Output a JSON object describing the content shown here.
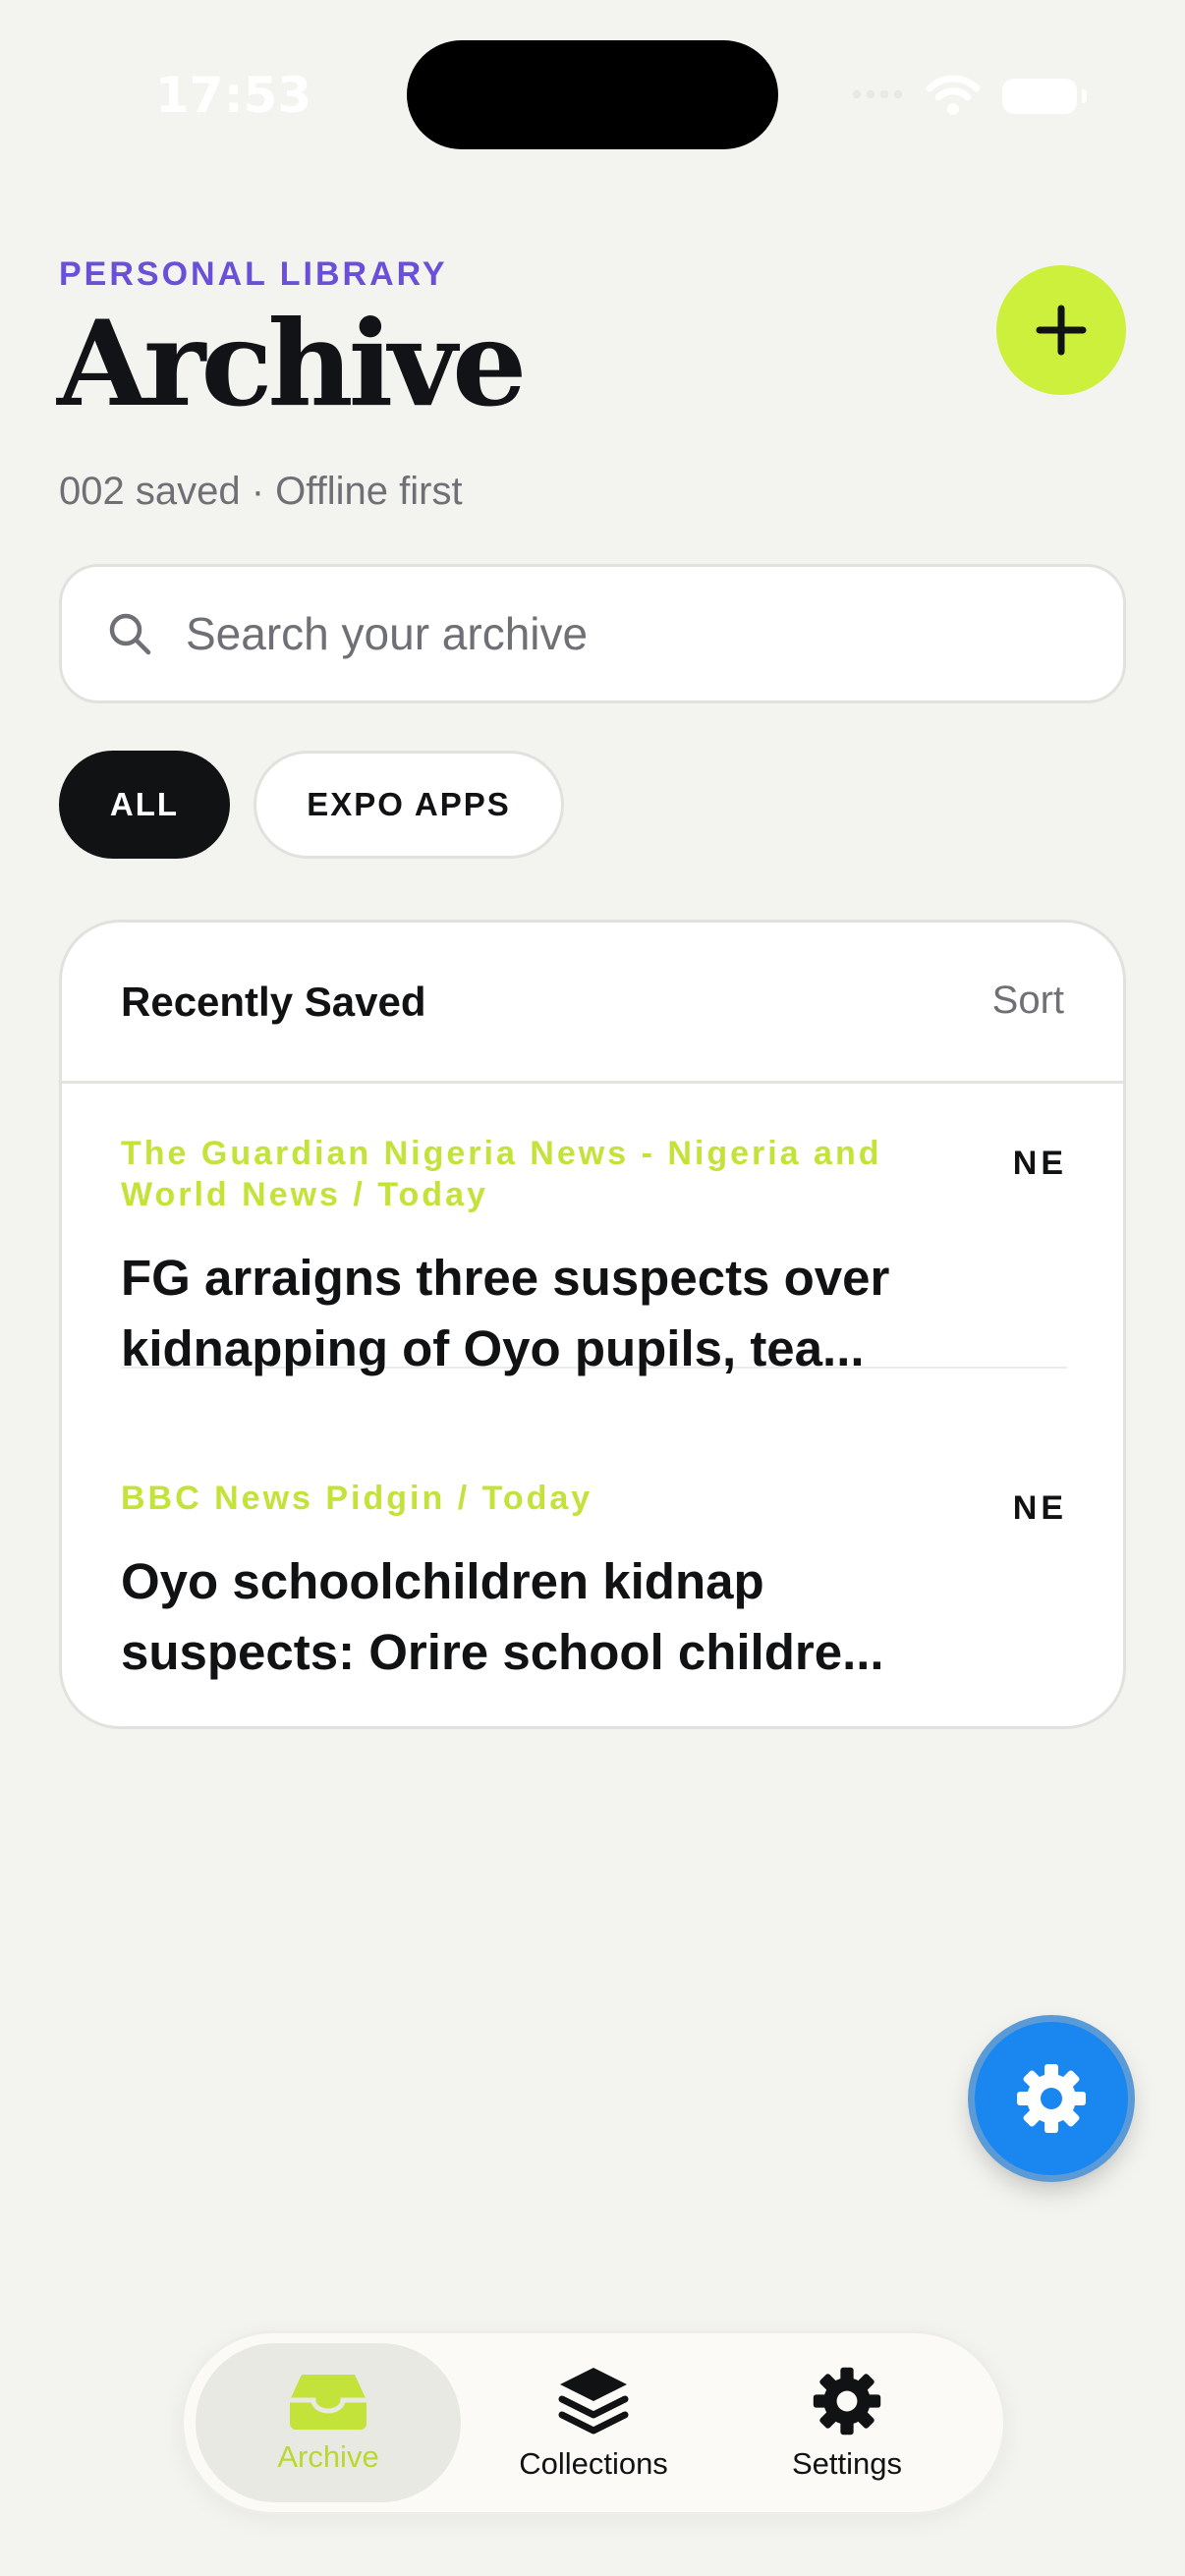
{
  "status_bar": {
    "time": "17:53"
  },
  "header": {
    "eyebrow": "PERSONAL LIBRARY",
    "title": "Archive",
    "subtitle": "002 saved · Offline first",
    "add_icon": "plus-icon"
  },
  "search": {
    "placeholder": "Search your archive",
    "value": ""
  },
  "filters": [
    {
      "label": "ALL",
      "selected": true
    },
    {
      "label": "EXPO APPS",
      "selected": false
    }
  ],
  "list": {
    "title": "Recently Saved",
    "sort_label": "Sort",
    "items": [
      {
        "source": "The Guardian Nigeria News - Nigeria and World News / Today",
        "badge": "NE",
        "title": "FG arraigns three suspects over kidnapping of Oyo pupils, tea..."
      },
      {
        "source": "BBC News Pidgin / Today",
        "badge": "NE",
        "title": "Oyo schoolchildren kidnap suspects: Orire school childre..."
      }
    ]
  },
  "floating_button": {
    "icon": "gear-icon"
  },
  "tab_bar": [
    {
      "label": "Archive",
      "icon": "inbox-tray-icon",
      "active": true
    },
    {
      "label": "Collections",
      "icon": "layers-icon",
      "active": false
    },
    {
      "label": "Settings",
      "icon": "gear-icon",
      "active": false
    }
  ],
  "colors": {
    "accent_lime": "#cdf03d",
    "accent_purple": "#6a4fd8",
    "source_lime": "#c3e23a",
    "fab_blue": "#1a86f0",
    "background": "#f3f3ef"
  }
}
